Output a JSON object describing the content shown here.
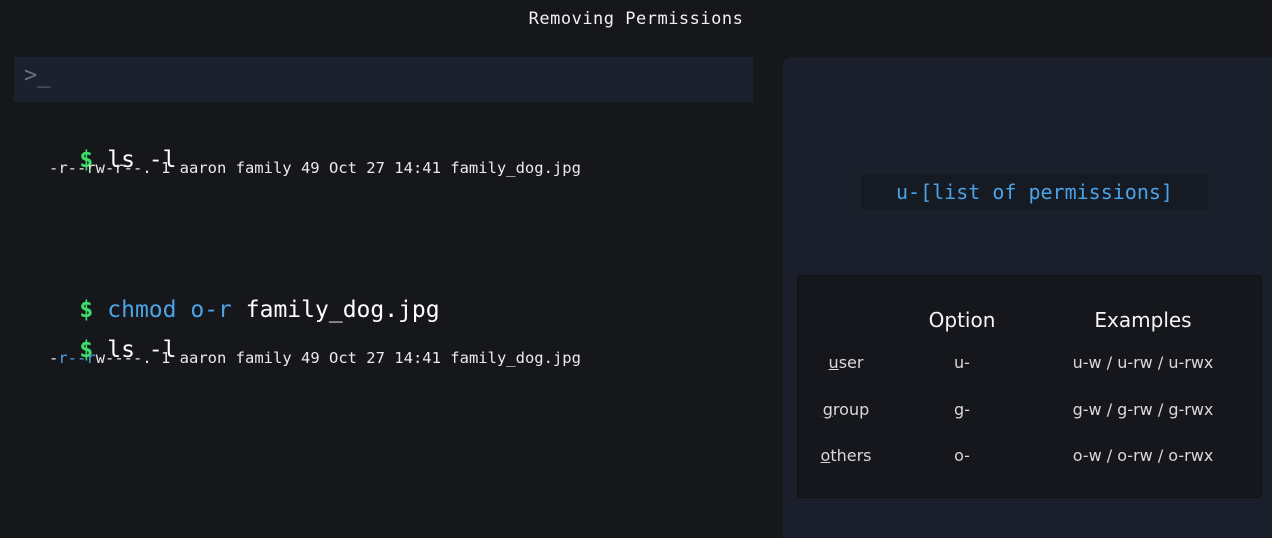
{
  "title": "Removing Permissions",
  "terminal": {
    "prompt_icon": ">_",
    "dollar": "$",
    "cmd1": "ls -l",
    "out1": "-r--rw-r--. 1 aaron family 49 Oct 27 14:41 family_dog.jpg",
    "cmd2": {
      "program": "chmod",
      "arg": "o-r",
      "file": "family_dog.jpg"
    },
    "cmd3": "ls -l",
    "out2": {
      "p1": "-",
      "p2": "r--",
      "p3": "r",
      "p4": "w----. 1 aaron family 49 Oct 27 14:41 family_dog.jpg"
    }
  },
  "panel": {
    "syntax": "u-[list of permissions]",
    "table": {
      "headers": [
        "Option",
        "Examples"
      ],
      "rows": [
        {
          "first": "u",
          "rest": "ser",
          "option": "u-",
          "examples": "u-w / u-rw / u-rwx"
        },
        {
          "first": "g",
          "rest": "roup",
          "option": "g-",
          "examples": "g-w / g-rw / g-rwx"
        },
        {
          "first": "o",
          "rest": "thers",
          "option": "o-",
          "examples": "o-w / o-rw / o-rwx"
        }
      ]
    }
  },
  "colors": {
    "prompt": "#3ee06a",
    "keyword": "#4aa3e6",
    "background": "#16171b",
    "panel": "#1b1f2b"
  },
  "icons": {
    "prompt_icon": "terminal-prompt-icon"
  }
}
